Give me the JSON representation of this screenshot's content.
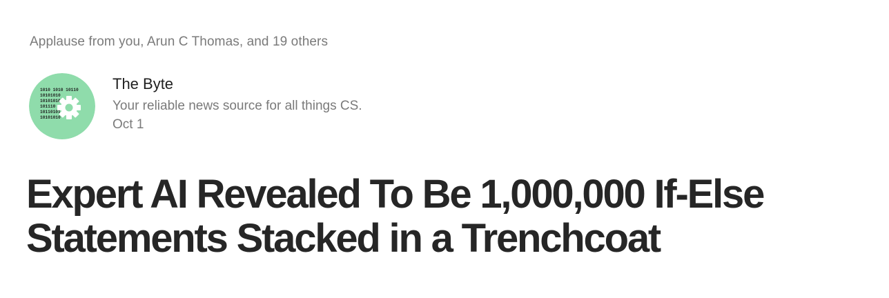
{
  "post": {
    "applause_text": "Applause from you, Arun C Thomas, and 19 others",
    "publication": {
      "name": "The Byte",
      "description": "Your reliable news source for all things CS.",
      "date": "Oct 1",
      "avatar": {
        "icon": "binary-gear-logo",
        "background_color": "#8fdcab",
        "logo_text": [
          "1010 1010 10110",
          "10101010",
          "10101010",
          "101110",
          "10110101",
          "10101010"
        ]
      }
    },
    "title": "Expert AI Revealed To Be 1,000,000 If-Else Statements Stacked in a Trenchcoat"
  }
}
